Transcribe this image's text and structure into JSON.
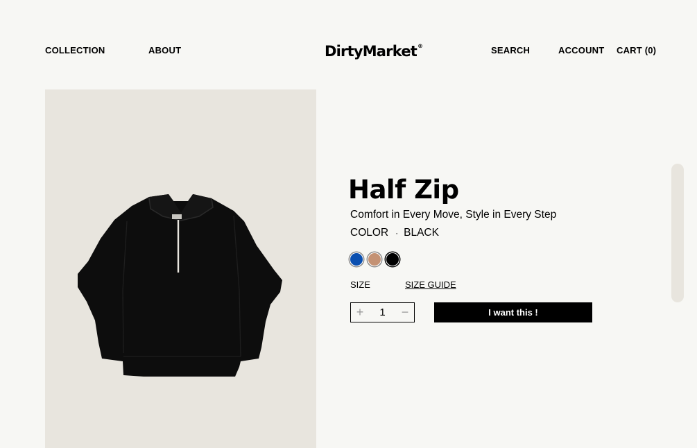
{
  "header": {
    "nav_left": [
      "COLLECTION",
      "ABOUT"
    ],
    "logo": "DirtyMarket",
    "logo_mark": "®",
    "nav_right": [
      "SEARCH",
      "ACCOUNT",
      "CART (0)"
    ]
  },
  "product": {
    "image_icon": "black-half-zip-sweatshirt",
    "title": "Half Zip",
    "subtitle": "Comfort in Every Move, Style in Every Step",
    "color_label": "COLOR",
    "color_separator": "·",
    "color_value": "BLACK",
    "swatches": [
      {
        "name": "blue",
        "color": "#0a4fb0"
      },
      {
        "name": "tan",
        "color": "#c49274"
      },
      {
        "name": "black",
        "color": "#000000"
      }
    ],
    "size_label": "SIZE",
    "size_guide": "SIZE GUIDE",
    "quantity": "1",
    "cta": "I want this !"
  },
  "colors": {
    "background": "#f7f7f4",
    "image_panel": "#e8e5de",
    "cta_bg": "#000000",
    "cta_text": "#ffffff"
  }
}
